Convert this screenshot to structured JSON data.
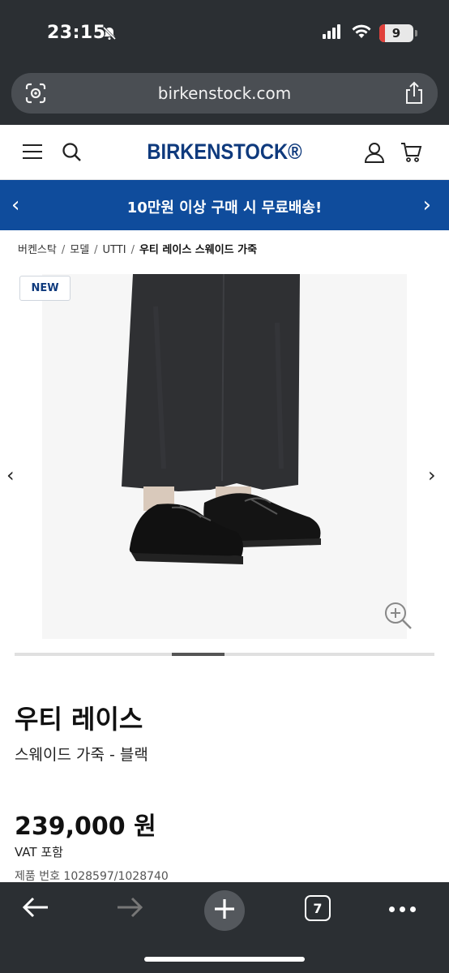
{
  "status_bar": {
    "time": "23:15",
    "battery": "9"
  },
  "browser": {
    "url": "birkenstock.com",
    "open_tabs": "7"
  },
  "header": {
    "logo": "BIRKENSTOCK®"
  },
  "promo": {
    "text": "10만원 이상 구매 시 무료배송!",
    "prev": "‹",
    "next": "›"
  },
  "breadcrumb": [
    "버켄스탁",
    "모델",
    "UTTI",
    "우티 레이스 스웨이드 가죽"
  ],
  "gallery": {
    "badge": "NEW",
    "prev": "‹",
    "next": "›",
    "progress": {
      "position": 0.375,
      "fraction": 0.125
    }
  },
  "product": {
    "title": "우티 레이스",
    "subtitle": "스웨이드 가죽 - 블랙",
    "price": "239,000 원",
    "vat": "VAT 포함",
    "sku": "제품 번호 1028597/1028740"
  },
  "colors": {
    "brand_blue": "#0f3a7d",
    "promo_blue": "#0f4c9c",
    "browser_dark": "#2b2f33"
  }
}
